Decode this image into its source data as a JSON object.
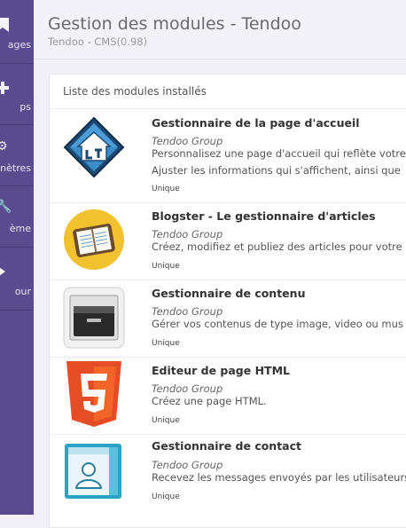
{
  "sidebar": {
    "items": [
      {
        "icon": "bookmark-icon",
        "label": "ages"
      },
      {
        "icon": "apps-icon",
        "label": "ps"
      },
      {
        "icon": "gears-icon",
        "label": "nètres"
      },
      {
        "icon": "wrench-icon",
        "label": "ème"
      },
      {
        "icon": "arrow-icon",
        "label": "our"
      }
    ]
  },
  "header": {
    "title": "Gestion des modules - Tendoo",
    "subtitle": "Tendoo - CMS(0.98)"
  },
  "panel": {
    "title": "Liste des modules installés"
  },
  "modules": [
    {
      "name": "Gestionnaire de la page d'accueil",
      "author": "Tendoo Group",
      "desc1": "Personnalisez une page d'accueil qui reflète votre",
      "desc2": "Ajuster les informations qui s'affichent, ainsi que",
      "type": "Unique"
    },
    {
      "name": "Blogster - Le gestionnaire d'articles",
      "author": "Tendoo Group",
      "desc1": "Créez, modifiez et publiez des articles pour votre",
      "type": "Unique"
    },
    {
      "name": "Gestionnaire de contenu",
      "author": "Tendoo Group",
      "desc1": "Gérer vos contenus de type image, video ou mus",
      "type": "Unique"
    },
    {
      "name": "Editeur de page HTML",
      "author": "Tendoo Group",
      "desc1": "Créez une page HTML.",
      "type": "Unique"
    },
    {
      "name": "Gestionnaire de contact",
      "author": "Tendoo Group",
      "desc1": "Recevez les messages envoyés par les utilisateurs",
      "type": "Unique"
    }
  ]
}
